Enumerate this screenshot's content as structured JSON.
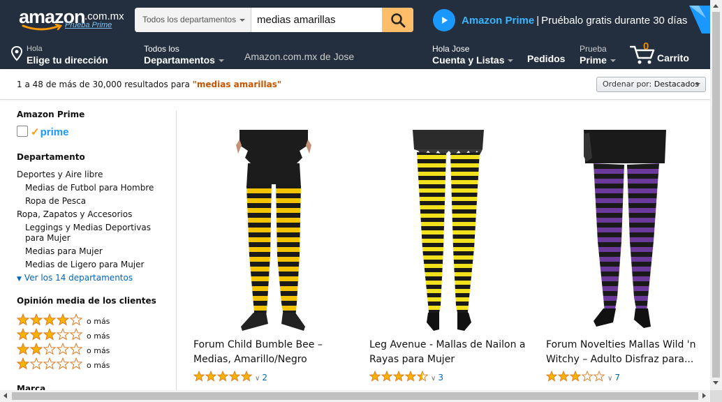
{
  "header": {
    "logo_word": "amazon",
    "logo_tld": ".com.mx",
    "logo_prime": "Prueba Prime",
    "search": {
      "department": "Todos los departamentos",
      "query": "medias amarillas",
      "button_icon": "search-icon"
    },
    "prime_ad": {
      "brand": "Amazon Prime",
      "separator": "|",
      "text": "Pruébalo gratis durante 30 días"
    }
  },
  "nav": {
    "address": {
      "line1": "Hola",
      "line2": "Elige tu dirección"
    },
    "departments": {
      "line1": "Todos los",
      "line2": "Departamentos"
    },
    "store": "Amazon.com.mx de Jose",
    "account": {
      "line1": "Hola Jose",
      "line2": "Cuenta y Listas"
    },
    "orders": "Pedidos",
    "prime": {
      "line1": "Prueba",
      "line2": "Prime"
    },
    "cart": {
      "count": "0",
      "label": "Carrito"
    }
  },
  "results": {
    "summary": "1 a 48 de más de 30,000 resultados para ",
    "query_quoted": "\"medias amarillas\"",
    "sort_label": "Ordenar por:",
    "sort_value": "Destacados"
  },
  "sidebar": {
    "prime_heading": "Amazon Prime",
    "prime_logo": "prime",
    "department_heading": "Departamento",
    "departments": [
      "Deportes y Aire libre",
      "Medias de Futbol para Hombre",
      "Ropa de Pesca",
      "Ropa, Zapatos y Accesorios",
      "Leggings y Medias Deportivas",
      "para Mujer",
      "Medias para Mujer",
      "Medias de Ligero para Mujer"
    ],
    "see_all": "Ver los 14 departamentos",
    "rating_heading": "Opinión media de los clientes",
    "ratings": [
      {
        "stars": 4,
        "label": "o más"
      },
      {
        "stars": 3,
        "label": "o más"
      },
      {
        "stars": 2,
        "label": "o más"
      },
      {
        "stars": 1,
        "label": "o más"
      }
    ],
    "brand_heading": "Marca"
  },
  "products": [
    {
      "title_line1": "Forum Child Bumble Bee –",
      "title_line2": " Medias, Amarillo/Negro",
      "rating": 5,
      "reviews": "2",
      "stripe_colors": [
        "#f4c400",
        "#1a1a1a"
      ]
    },
    {
      "title_line1": "Leg Avenue - Mallas de Nailon a",
      "title_line2": "Rayas para Mujer",
      "rating": 4.5,
      "reviews": "3",
      "stripe_colors": [
        "#f2e21e",
        "#1a1a1a"
      ]
    },
    {
      "title_line1": "Forum Novelties Mallas Wild 'n",
      "title_line2": "Witchy – Adulto Disfraz para...",
      "rating": 3,
      "reviews": "7",
      "stripe_colors": [
        "#6b3a9a",
        "#1a1a1a"
      ]
    }
  ],
  "colors": {
    "nav_bg": "#232f3e",
    "search_button": "#febd69",
    "link_blue": "#0066c0",
    "query_orange": "#c45500",
    "star_fill": "#f8b400",
    "prime_blue": "#1a98ff"
  }
}
